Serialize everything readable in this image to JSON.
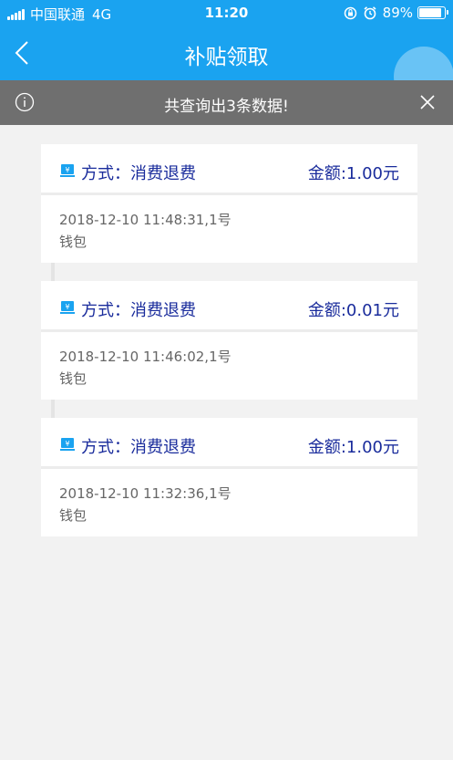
{
  "status": {
    "carrier": "中国联通",
    "network": "4G",
    "time": "11:20",
    "battery": "89%",
    "battery_level": 0.89
  },
  "nav": {
    "title": "补贴领取"
  },
  "notice": {
    "text": "共查询出3条数据!"
  },
  "records": [
    {
      "method": "方式：消费退费",
      "amount": "金额:1.00元",
      "time": "2018-12-10 11:48:31,1号",
      "source": "钱包"
    },
    {
      "method": "方式：消费退费",
      "amount": "金额:0.01元",
      "time": "2018-12-10 11:46:02,1号",
      "source": "钱包"
    },
    {
      "method": "方式：消费退费",
      "amount": "金额:1.00元",
      "time": "2018-12-10 11:32:36,1号",
      "source": "钱包"
    }
  ],
  "colors": {
    "primary": "#1aa3f0",
    "notice_bg": "#6f6f6f",
    "text_blue": "#1a2c9c",
    "text_gray": "#666666"
  }
}
